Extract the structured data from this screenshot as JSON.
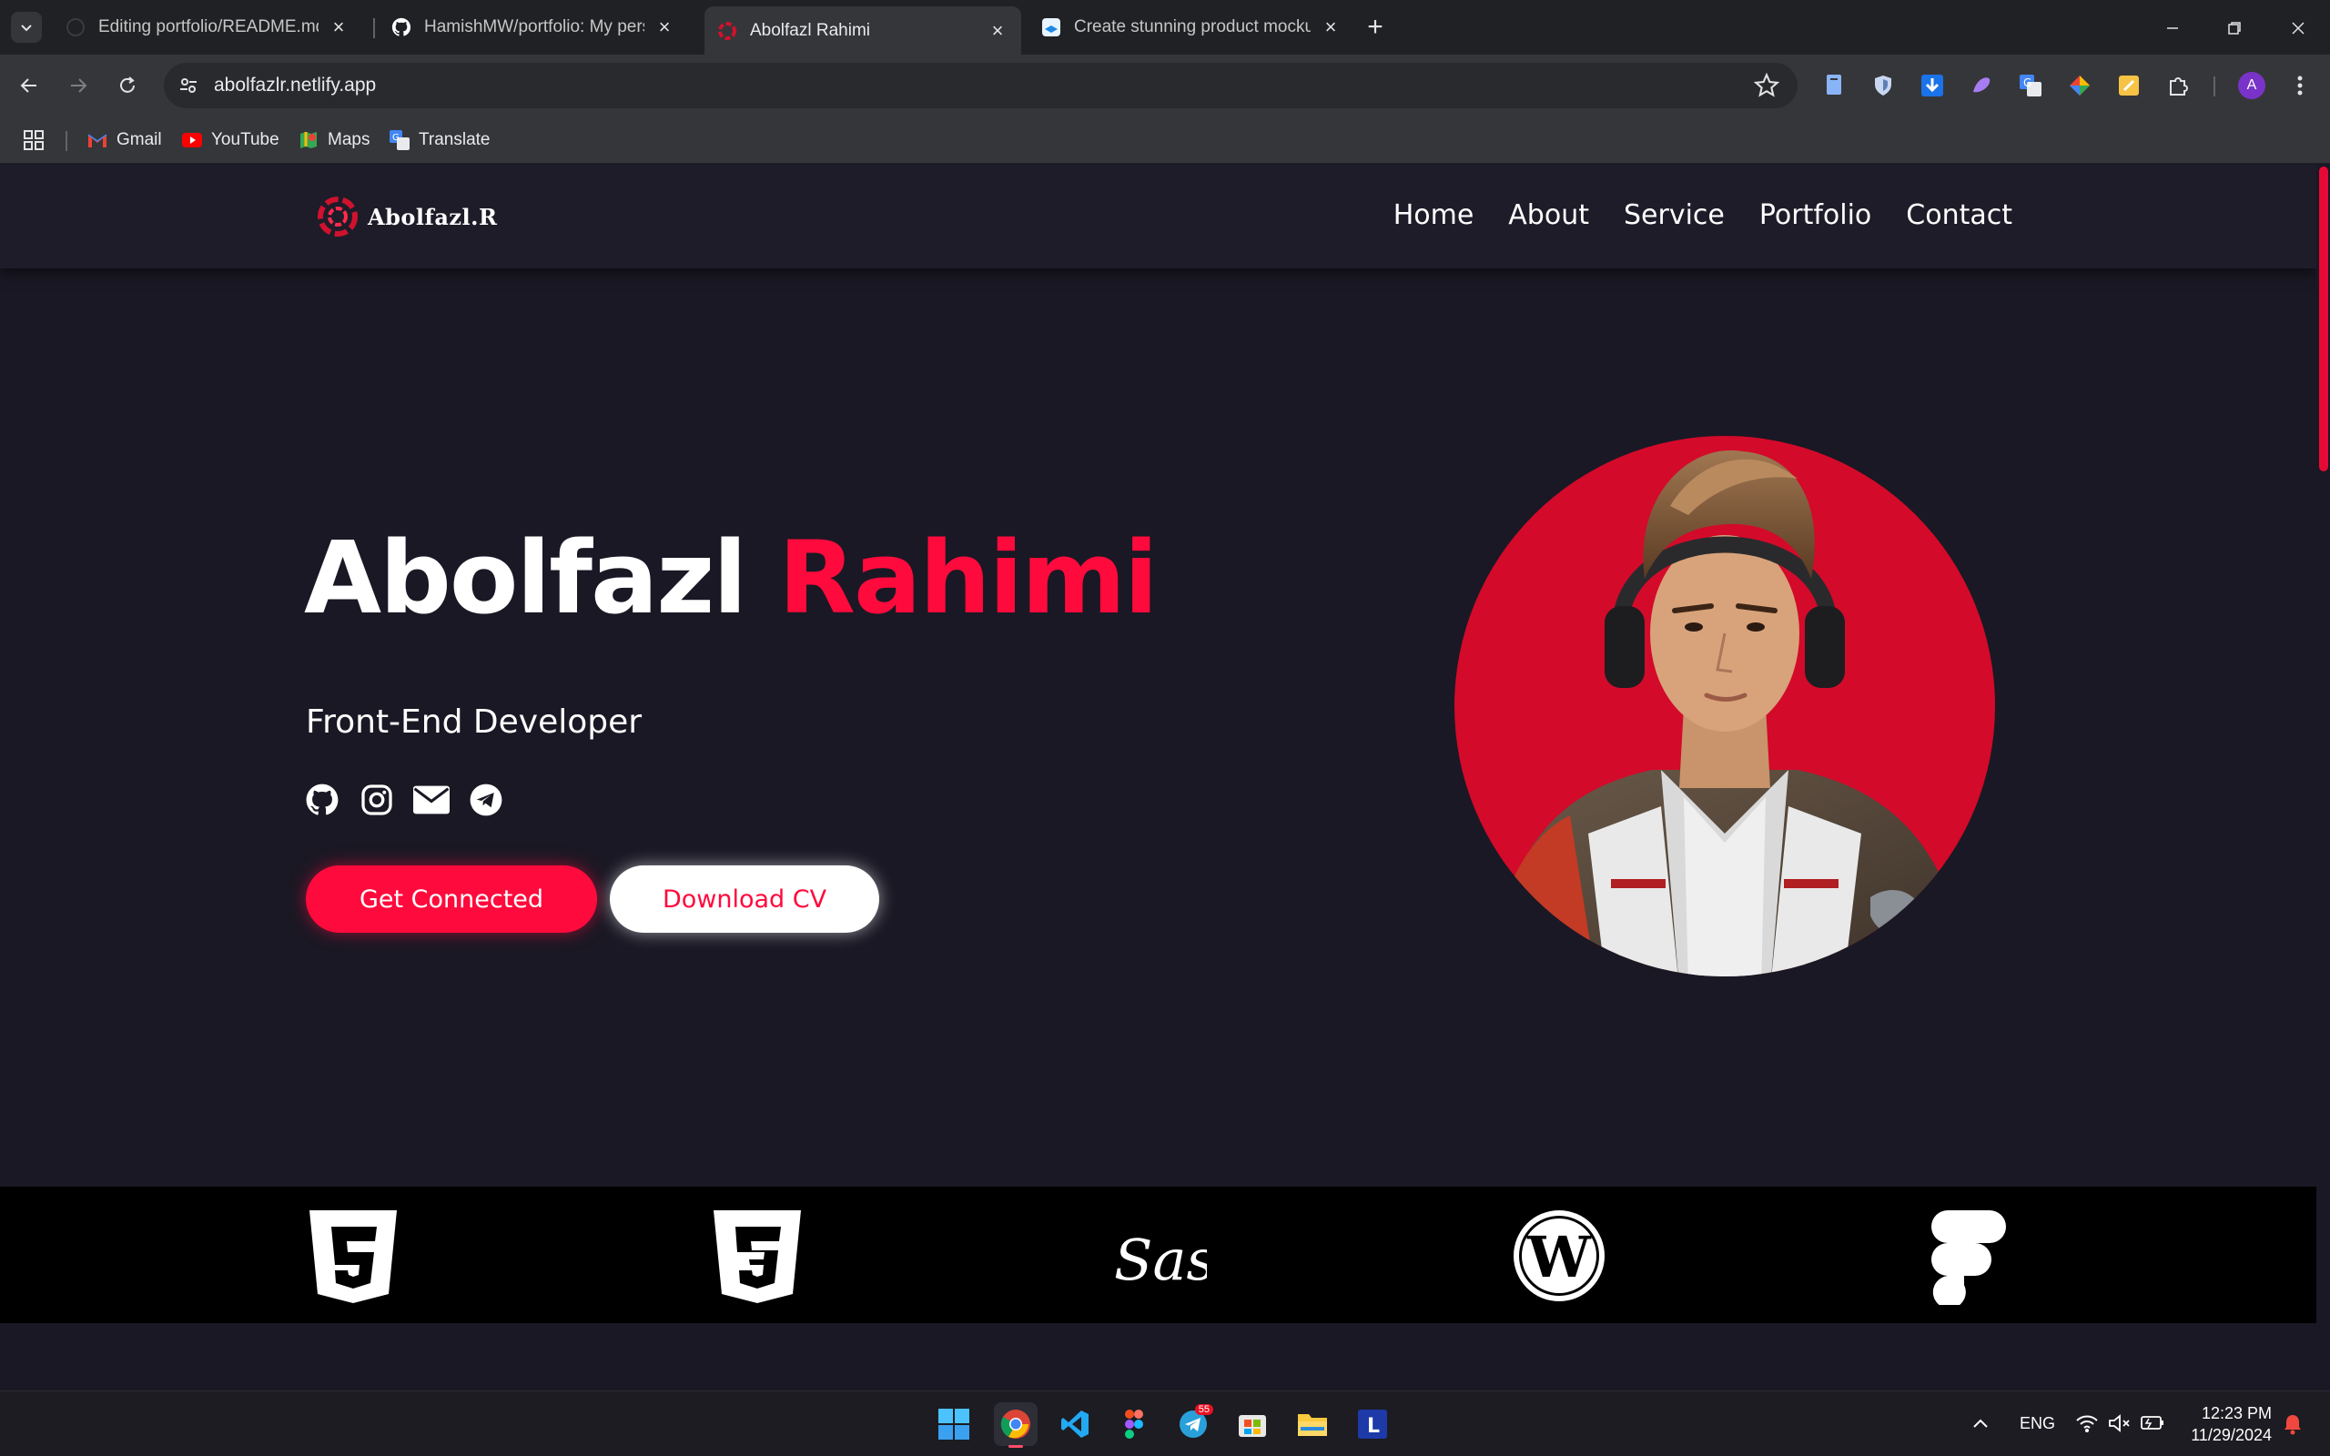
{
  "browser": {
    "tabs": [
      {
        "title": "Editing portfolio/README.md a",
        "icon": "github-icon"
      },
      {
        "title": "HamishMW/portfolio: My perso",
        "icon": "github-icon"
      },
      {
        "title": "Abolfazl Rahimi",
        "icon": "site-logo-icon",
        "active": true
      },
      {
        "title": "Create stunning product mocku",
        "icon": "mockup-icon"
      }
    ],
    "url": "abolfazlr.netlify.app",
    "profile_initial": "A",
    "bookmarks": [
      {
        "label": "Gmail",
        "icon": "gmail-icon"
      },
      {
        "label": "YouTube",
        "icon": "youtube-icon"
      },
      {
        "label": "Maps",
        "icon": "maps-icon"
      },
      {
        "label": "Translate",
        "icon": "translate-icon"
      }
    ]
  },
  "site": {
    "logo_text": "Abolfazl.R",
    "nav": [
      "Home",
      "About",
      "Service",
      "Portfolio",
      "Contact"
    ],
    "hero": {
      "first_name": "Abolfazl",
      "last_name": "Rahimi",
      "role": "Front-End Developer",
      "primary_cta": "Get Connected",
      "secondary_cta": "Download CV",
      "socials": [
        "github-icon",
        "instagram-icon",
        "mail-icon",
        "telegram-icon"
      ]
    },
    "skills": [
      "html5-icon",
      "css3-icon",
      "sass-icon",
      "wordpress-icon",
      "figma-icon"
    ],
    "colors": {
      "accent": "#ff0a3c",
      "background": "#1a1824",
      "nav": "#1e1c29"
    }
  },
  "taskbar": {
    "apps": [
      "windows-start-icon",
      "chrome-icon",
      "vscode-icon",
      "figma-icon",
      "telegram-icon",
      "store-icon",
      "file-explorer-icon",
      "app-l-icon"
    ],
    "telegram_badge": "55",
    "language": "ENG",
    "time": "12:23 PM",
    "date": "11/29/2024"
  }
}
